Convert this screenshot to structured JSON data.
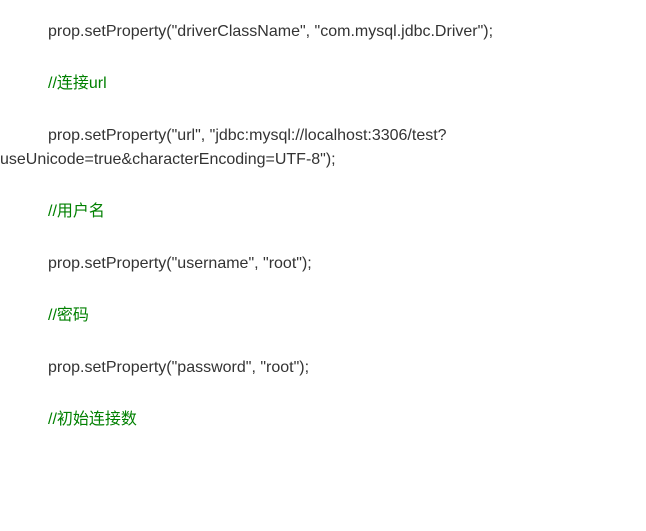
{
  "lines": {
    "line1": "prop.setProperty(\"driverClassName\", \"com.mysql.jdbc.Driver\");",
    "comment1": "//连接url",
    "line2a": "prop.setProperty(\"url\", \"jdbc:mysql://localhost:3306/test?",
    "line2b": "useUnicode=true&characterEncoding=UTF-8\");",
    "comment2": "//用户名",
    "line3": "prop.setProperty(\"username\", \"root\");",
    "comment3": "//密码",
    "line4": "prop.setProperty(\"password\", \"root\");",
    "comment4": "//初始连接数"
  }
}
